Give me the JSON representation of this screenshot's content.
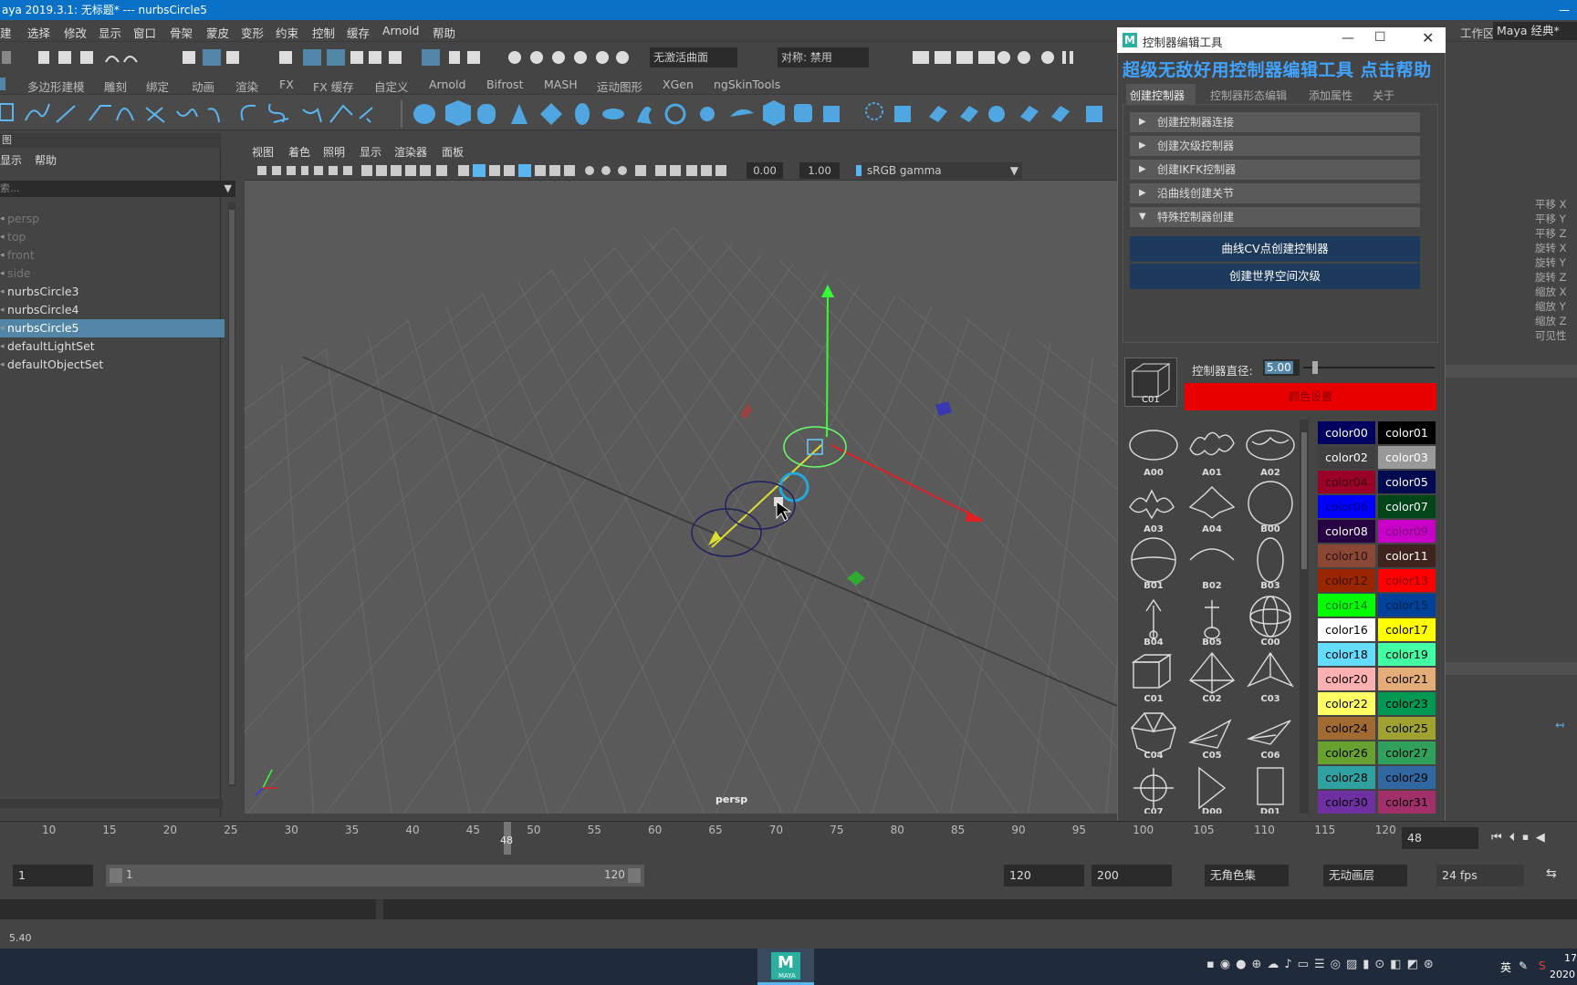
{
  "window": {
    "title": "aya 2019.3.1: 无标题*   ---   nurbsCircle5",
    "min_icon": "minimize-icon"
  },
  "menubar": {
    "items": [
      "建",
      "选择",
      "修改",
      "显示",
      "窗口",
      "骨架",
      "蒙皮",
      "变形",
      "约束",
      "控制",
      "缓存",
      "Arnold",
      "帮助"
    ],
    "workspace_label": "工作区:",
    "workspace_value": "Maya 经典*"
  },
  "statusline": {
    "no_live_surface": "无激活曲面",
    "symmetry": "对称: 禁用"
  },
  "shelf_tabs": [
    "多边形建模",
    "雕刻",
    "绑定",
    "动画",
    "渲染",
    "FX",
    "FX 缓存",
    "自定义",
    "Arnold",
    "Bifrost",
    "MASH",
    "运动图形",
    "XGen",
    "ngSkinTools"
  ],
  "outliner": {
    "header": "图",
    "menu": [
      "显示",
      "帮助"
    ],
    "search_placeholder": "索...",
    "items": [
      {
        "label": "persp",
        "state": "dim"
      },
      {
        "label": "top",
        "state": "dim"
      },
      {
        "label": "front",
        "state": "dim"
      },
      {
        "label": "side",
        "state": "dim"
      },
      {
        "label": "nurbsCircle3",
        "state": "normal"
      },
      {
        "label": "nurbsCircle4",
        "state": "normal"
      },
      {
        "label": "nurbsCircle5",
        "state": "selected"
      },
      {
        "label": "defaultLightSet",
        "state": "normal"
      },
      {
        "label": "defaultObjectSet",
        "state": "normal"
      }
    ]
  },
  "viewport": {
    "menu": [
      "视图",
      "着色",
      "照明",
      "显示",
      "渲染器",
      "面板"
    ],
    "field_a": "0.00",
    "field_b": "1.00",
    "color_space": "sRGB gamma",
    "camera_label": "persp"
  },
  "controller_tool": {
    "window_title": "控制器编辑工具",
    "banner": "超级无敌好用控制器编辑工具 点击帮助",
    "tabs": [
      "创建控制器",
      "控制器形态编辑",
      "添加属性",
      "关于"
    ],
    "sections": [
      {
        "label": "创建控制器连接",
        "expanded": false
      },
      {
        "label": "创建次级控制器",
        "expanded": false
      },
      {
        "label": "创建IKFK控制器",
        "expanded": false
      },
      {
        "label": "沿曲线创建关节",
        "expanded": false
      },
      {
        "label": "特殊控制器创建",
        "expanded": true
      }
    ],
    "buttons": [
      "曲线CV点创建控制器",
      "创建世界空间次级"
    ],
    "diameter_label": "控制器直径:",
    "diameter_value": "5.00",
    "preview_label": "C01",
    "set_color_button": "颜色设置",
    "set_color_hex": "#e80000",
    "shapes": [
      [
        "A00",
        "A01",
        "A02"
      ],
      [
        "A03",
        "A04",
        "B00"
      ],
      [
        "B01",
        "B02",
        "B03"
      ],
      [
        "B04",
        "B05",
        "C00"
      ],
      [
        "C01",
        "C02",
        "C03"
      ],
      [
        "C04",
        "C05",
        "C06"
      ],
      [
        "C07",
        "D00",
        "D01"
      ]
    ],
    "colors": [
      {
        "name": "color00",
        "bg": "#000060",
        "fg": "#ffffff"
      },
      {
        "name": "color01",
        "bg": "#000000",
        "fg": "#ffffff"
      },
      {
        "name": "color02",
        "bg": "#404040",
        "fg": "#ffffff"
      },
      {
        "name": "color03",
        "bg": "#999999",
        "fg": "#ffffff"
      },
      {
        "name": "color04",
        "bg": "#9b0028",
        "fg": "#3a0010"
      },
      {
        "name": "color05",
        "bg": "#000a50",
        "fg": "#ffffff"
      },
      {
        "name": "color06",
        "bg": "#0000ff",
        "fg": "#00007a"
      },
      {
        "name": "color07",
        "bg": "#004619",
        "fg": "#ffffff"
      },
      {
        "name": "color08",
        "bg": "#260043",
        "fg": "#ffffff"
      },
      {
        "name": "color09",
        "bg": "#c800c8",
        "fg": "#7a007a"
      },
      {
        "name": "color10",
        "bg": "#8a4834",
        "fg": "#2a1010"
      },
      {
        "name": "color11",
        "bg": "#3f231f",
        "fg": "#ffffff"
      },
      {
        "name": "color12",
        "bg": "#992600",
        "fg": "#3a0e00"
      },
      {
        "name": "color13",
        "bg": "#ff0000",
        "fg": "#8a0000"
      },
      {
        "name": "color14",
        "bg": "#00ff00",
        "fg": "#006a00"
      },
      {
        "name": "color15",
        "bg": "#004199",
        "fg": "#002050"
      },
      {
        "name": "color16",
        "bg": "#ffffff",
        "fg": "#000000"
      },
      {
        "name": "color17",
        "bg": "#ffff00",
        "fg": "#000000"
      },
      {
        "name": "color18",
        "bg": "#64dcff",
        "fg": "#000000"
      },
      {
        "name": "color19",
        "bg": "#43ffa3",
        "fg": "#000000"
      },
      {
        "name": "color20",
        "bg": "#ffb0b0",
        "fg": "#000000"
      },
      {
        "name": "color21",
        "bg": "#e4ac79",
        "fg": "#000000"
      },
      {
        "name": "color22",
        "bg": "#ffff63",
        "fg": "#000000"
      },
      {
        "name": "color23",
        "bg": "#009954",
        "fg": "#000000"
      },
      {
        "name": "color24",
        "bg": "#a16a30",
        "fg": "#000000"
      },
      {
        "name": "color25",
        "bg": "#9fa130",
        "fg": "#000000"
      },
      {
        "name": "color26",
        "bg": "#68a130",
        "fg": "#000000"
      },
      {
        "name": "color27",
        "bg": "#30a15d",
        "fg": "#000000"
      },
      {
        "name": "color28",
        "bg": "#30a1a1",
        "fg": "#000000"
      },
      {
        "name": "color29",
        "bg": "#3067a1",
        "fg": "#000000"
      },
      {
        "name": "color30",
        "bg": "#6f30a1",
        "fg": "#000000"
      },
      {
        "name": "color31",
        "bg": "#a1306a",
        "fg": "#000000"
      }
    ]
  },
  "channel_box": {
    "attrs": [
      "平移 X",
      "平移 Y",
      "平移 Z",
      "旋转 X",
      "旋转 Y",
      "旋转 Z",
      "缩放 X",
      "缩放 Y",
      "缩放 Z",
      "可见性"
    ]
  },
  "timeline": {
    "ticks": [
      "10",
      "15",
      "20",
      "25",
      "30",
      "35",
      "40",
      "45",
      "50",
      "55",
      "60",
      "65",
      "70",
      "75",
      "80",
      "85",
      "90",
      "95",
      "100",
      "105",
      "110",
      "115",
      "120"
    ],
    "current_frame_marker": "48",
    "current_frame": "48"
  },
  "range": {
    "start": "1",
    "inner_start": "1",
    "inner_end": "120",
    "end": "120",
    "max": "200",
    "char_set": "无角色集",
    "anim_layer": "无动画层",
    "fps": "24 fps"
  },
  "help": {
    "value": "5.40"
  },
  "taskbar": {
    "maya_label": "MAYA",
    "ime": "英",
    "clock_top": "17",
    "clock_bottom": "2020"
  }
}
